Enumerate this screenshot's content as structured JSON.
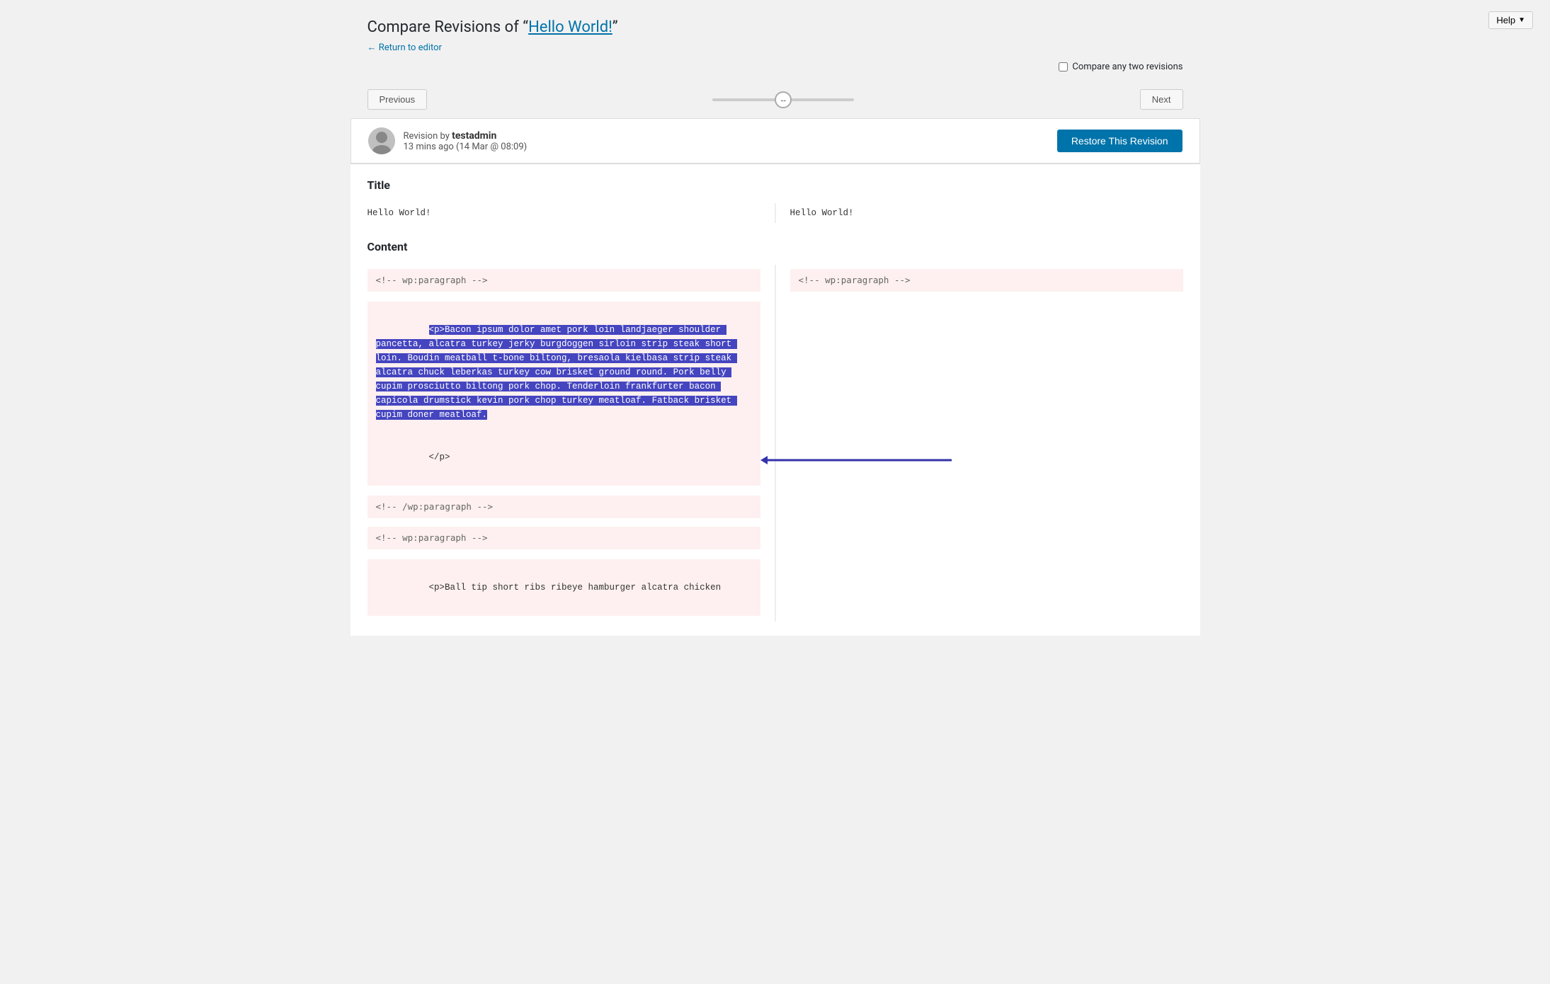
{
  "page": {
    "title_prefix": "Compare Revisions of “",
    "title_link_text": "Hello World!",
    "title_suffix": "”",
    "return_link": "← Return to editor",
    "help_button": "Help",
    "help_chevron": "▼"
  },
  "nav": {
    "previous_label": "Previous",
    "next_label": "Next",
    "compare_label": "Compare any two revisions"
  },
  "revision": {
    "prefix": "Revision by ",
    "author": "testadmin",
    "time_ago": "13 mins ago",
    "date": "(14 Mar @ 08:09)",
    "restore_button": "Restore This Revision"
  },
  "diff": {
    "title_section_label": "Title",
    "left_title": "Hello World!",
    "right_title": "Hello World!",
    "content_section_label": "Content",
    "left_wp_comment": "<!-- wp:paragraph -->",
    "right_wp_comment": "<!-- wp:paragraph -->",
    "left_removed_open": "<p>",
    "left_removed_text": "Bacon ipsum dolor amet pork loin landjaeger shoulder pancetta, alcatra turkey jerky burgdoggen sirloin strip steak short loin. Boudin meatball t-bone biltong, bresaola kielbasa strip steak alcatra chuck leberkas turkey cow brisket ground round. Pork belly cupim prosciutto biltong pork chop. Tenderloin frankfurter bacon capicola drumstick kevin pork chop turkey meatloaf. Fatback brisket cupim doner meatloaf.",
    "left_removed_close": "</p>",
    "left_wp_close": "<!-- /wp:paragraph -->",
    "left_wp_para2": "<!-- wp:paragraph -->",
    "left_para2_open": "<p>Ball tip short ribs ribeye hamburger alcatra chicken"
  }
}
